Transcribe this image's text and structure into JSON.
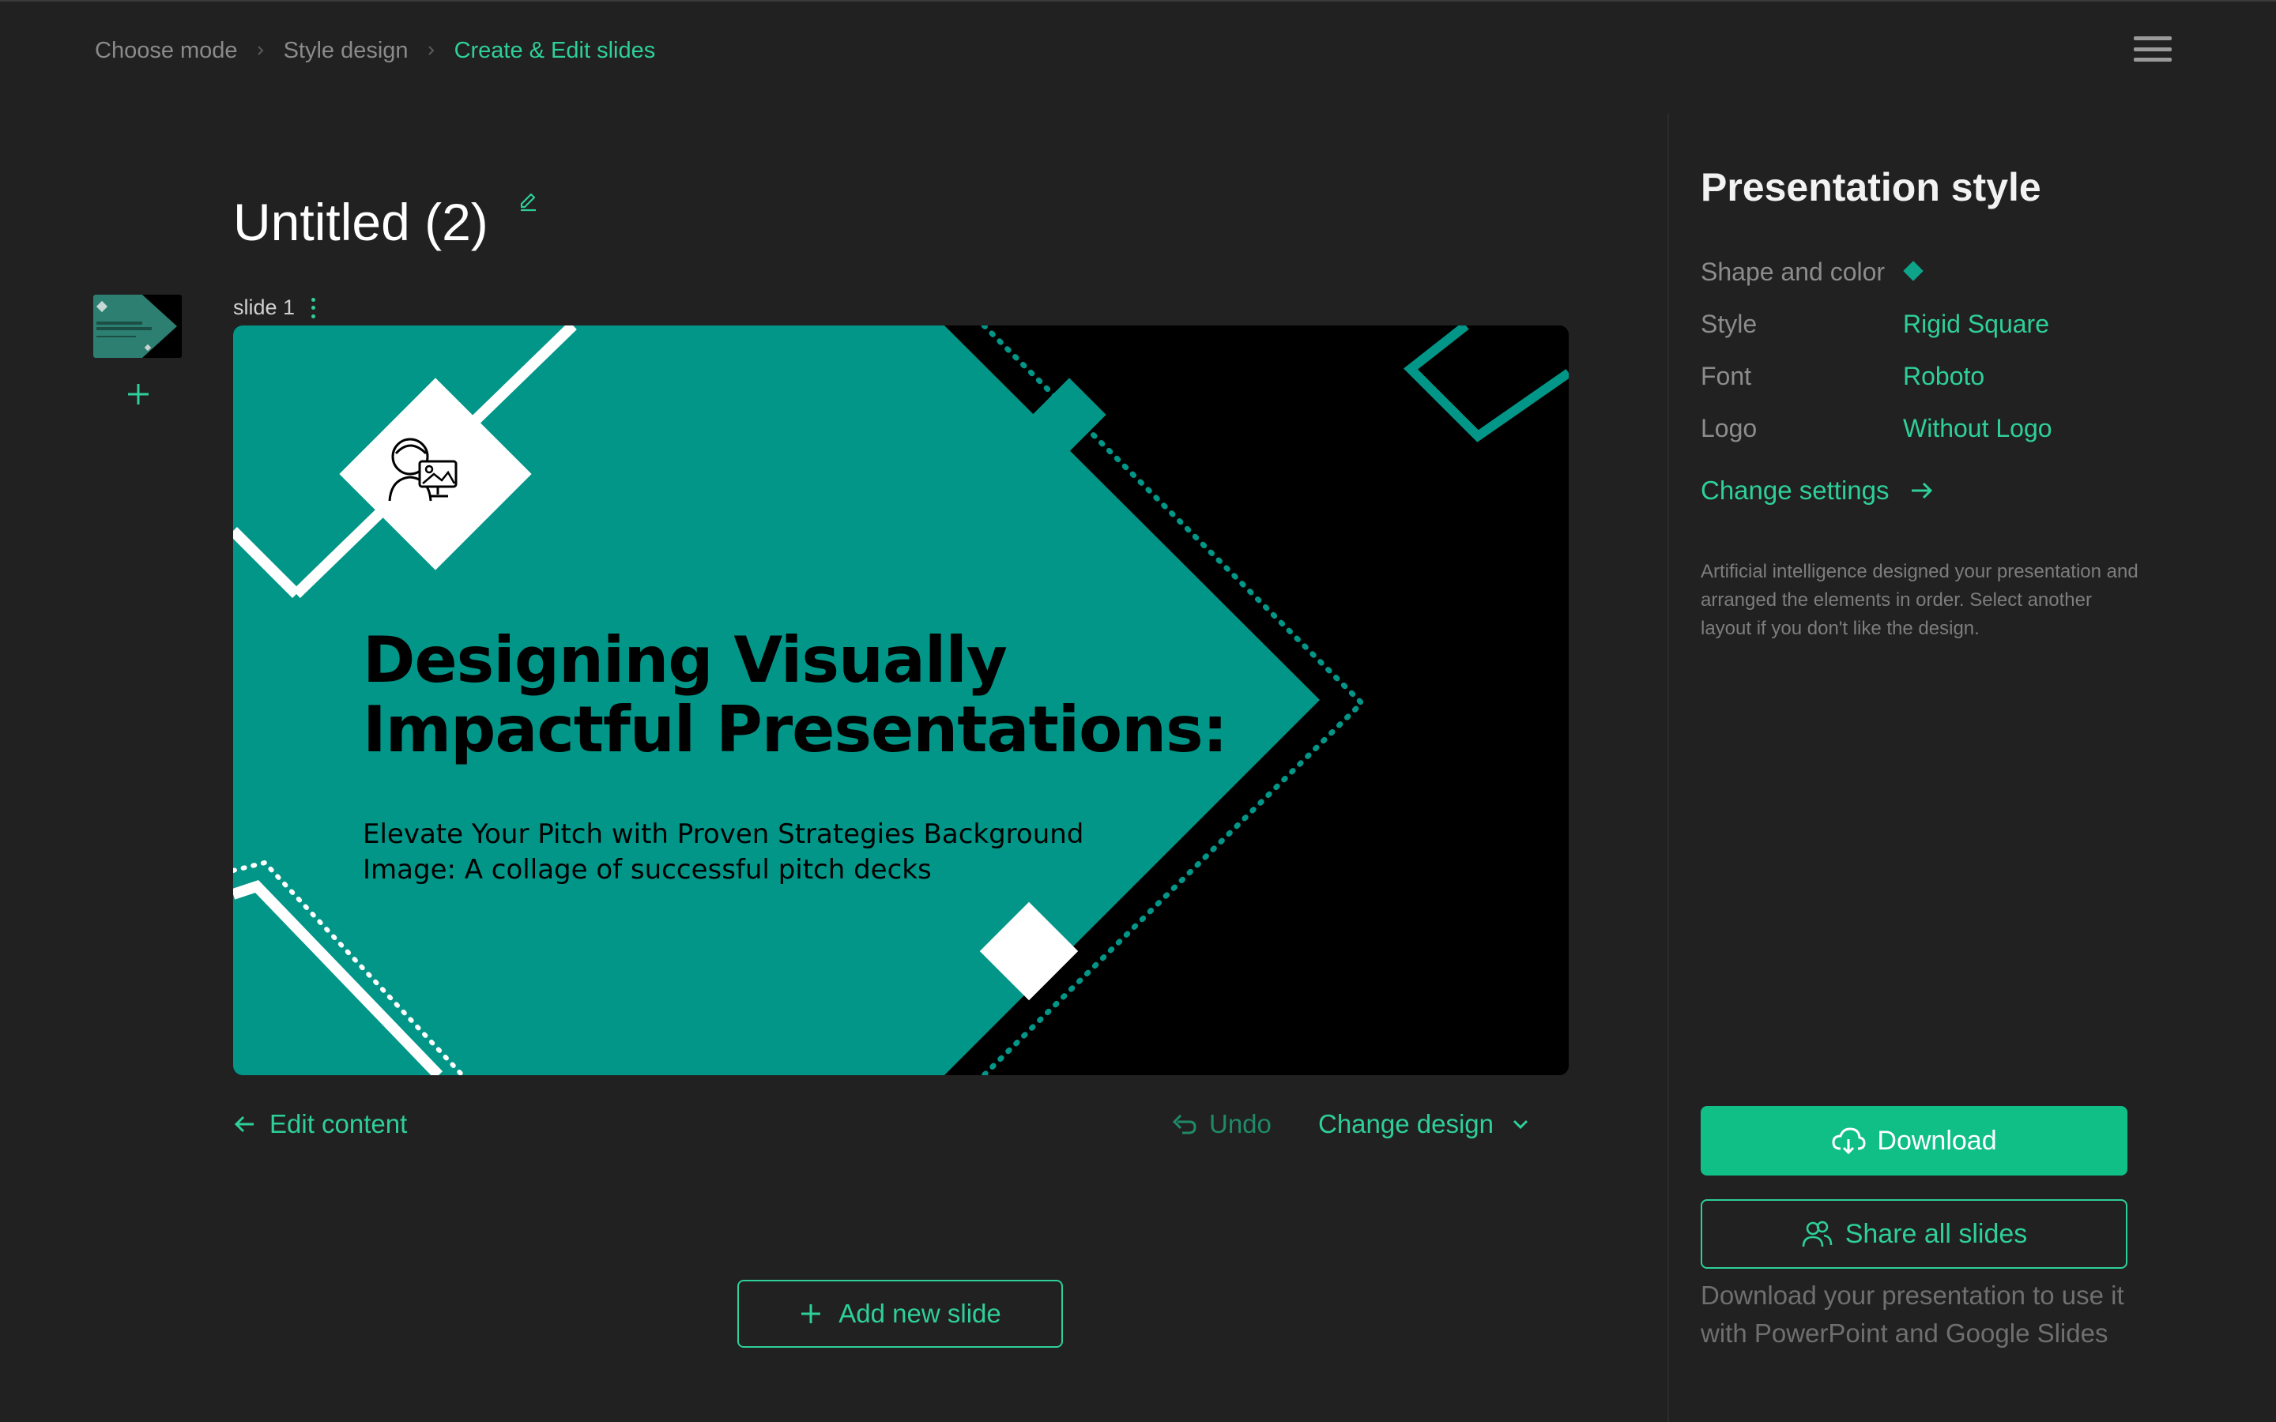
{
  "breadcrumb": {
    "steps": [
      {
        "label": "Choose mode"
      },
      {
        "label": "Style design"
      },
      {
        "label": "Create & Edit slides"
      }
    ]
  },
  "document": {
    "title": "Untitled (2)"
  },
  "slides": {
    "current_label": "slide 1",
    "slide1": {
      "title_line1": "Designing Visually",
      "title_line2": "Impactful Presentations:",
      "subtitle_line1": "Elevate Your Pitch with Proven Strategies Background",
      "subtitle_line2": "Image: A collage of successful pitch decks"
    }
  },
  "actions": {
    "edit_content": "Edit content",
    "undo": "Undo",
    "change_design": "Change design",
    "add_new_slide": "Add new slide"
  },
  "panel": {
    "title": "Presentation style",
    "shape_label": "Shape and color",
    "style_label": "Style",
    "style_value": "Rigid Square",
    "font_label": "Font",
    "font_value": "Roboto",
    "logo_label": "Logo",
    "logo_value": "Without Logo",
    "change_settings": "Change settings",
    "ai_note": "Artificial intelligence designed your presentation and arranged the elements in order. Select another layout if you don't like the design.",
    "download": "Download",
    "share_all": "Share all slides",
    "download_note": "Download your presentation to use it with PowerPoint and Google Slides"
  },
  "colors": {
    "accent": "#2ecf9a",
    "slide_teal": "#029688",
    "download_bg": "#0fbf86",
    "background": "#212121"
  },
  "icons": {
    "breadcrumb_sep": "chevron-right-icon",
    "menu": "hamburger-menu-icon",
    "edit": "pencil-icon",
    "add": "plus-icon",
    "back": "arrow-left-icon",
    "undo": "undo-arrow-icon",
    "dropdown": "chevron-down-icon",
    "forward": "arrow-right-icon",
    "download": "cloud-download-icon",
    "share": "users-icon",
    "slide_menu": "vertical-dots-icon"
  }
}
